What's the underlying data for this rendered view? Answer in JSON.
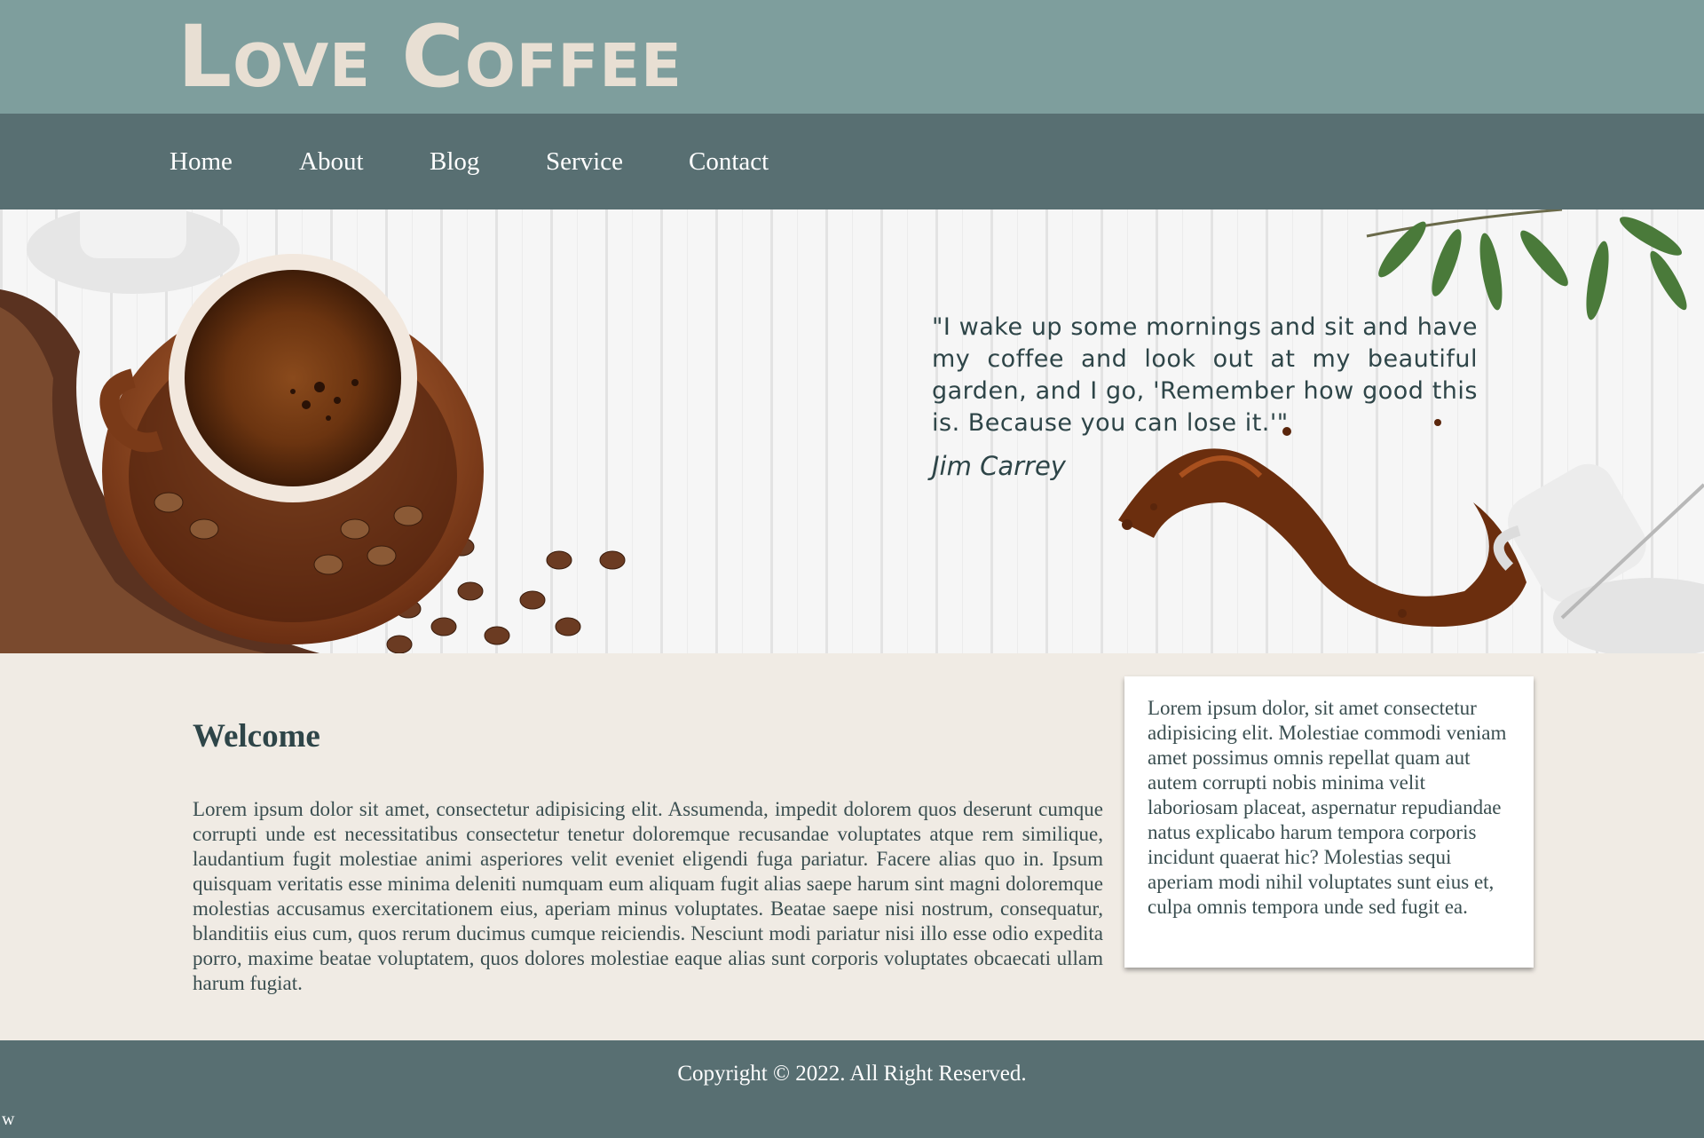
{
  "header": {
    "logo": "Love Coffee"
  },
  "nav": {
    "items": [
      "Home",
      "About",
      "Blog",
      "Service",
      "Contact"
    ]
  },
  "hero": {
    "quote": "\"I wake up some mornings and sit and have my coffee and look out at my beautiful garden, and I go, 'Remember how good this is. Because you can lose it.'\"",
    "author": "Jim Carrey"
  },
  "main": {
    "title": "Welcome",
    "body": "Lorem ipsum dolor sit amet, consectetur adipisicing elit. Assumenda, impedit dolorem quos deserunt cumque corrupti unde est necessitatibus consectetur tenetur doloremque recusandae voluptates atque rem similique, laudantium fugit molestiae animi asperiores velit eveniet eligendi fuga pariatur. Facere alias quo in. Ipsum quisquam veritatis esse minima deleniti numquam eum aliquam fugit alias saepe harum sint magni doloremque molestias accusamus exercitationem eius, aperiam minus voluptates. Beatae saepe nisi nostrum, consequatur, blanditiis eius cum, quos rerum ducimus cumque reiciendis. Nesciunt modi pariatur nisi illo esse odio expedita porro, maxime beatae voluptatem, quos dolores molestiae eaque alias sunt corporis voluptates obcaecati ullam harum fugiat.",
    "aside": "Lorem ipsum dolor, sit amet consectetur adipisicing elit. Molestiae commodi veniam amet possimus omnis repellat quam aut autem corrupti nobis minima velit laboriosam placeat, aspernatur repudiandae natus explicabo harum tempora corporis incidunt quaerat hic? Molestias sequi aperiam modi nihil voluptates sunt eius et, culpa omnis tempora unde sed fugit ea."
  },
  "footer": {
    "copyright": "Copyright © 2022. All Right Reserved.",
    "corner": "w"
  },
  "colors": {
    "header_bg": "#7e9e9d",
    "nav_bg": "#586f72",
    "logo_text": "#e8dfd3",
    "main_bg": "#f0ebe4",
    "text_dark": "#2e4548"
  },
  "icons": [
    "coffee-cup-image",
    "coffee-beans-image",
    "coffee-splash-image",
    "leaf-branch-image"
  ]
}
